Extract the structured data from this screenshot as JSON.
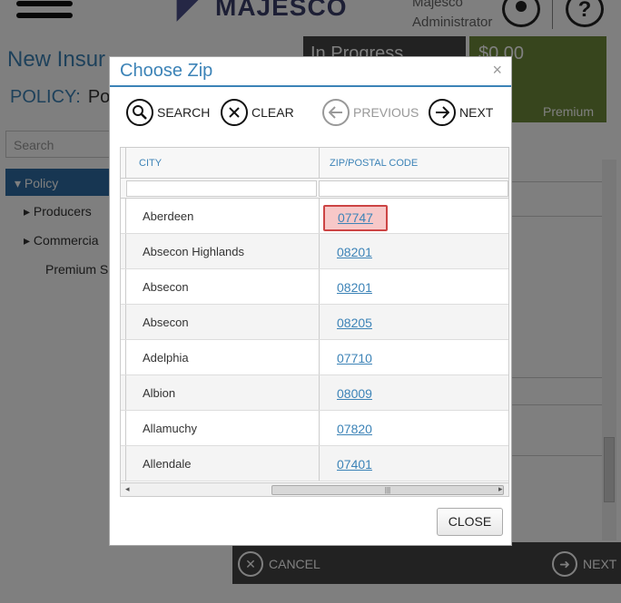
{
  "app": {
    "logo_text": "MAJESCO",
    "user_name": "Majesco",
    "user_role": "Administrator",
    "help_glyph": "?"
  },
  "page": {
    "title": "New Insur",
    "policy_label": "POLICY:",
    "policy_value": "Pol",
    "status": "In Progress",
    "premium_amount": "$0.00",
    "premium_label": "Premium"
  },
  "sidebar": {
    "search_placeholder": "Search",
    "items": [
      {
        "label": "Policy",
        "selected": true
      },
      {
        "label": "Producers"
      },
      {
        "label": "Commercia"
      },
      {
        "label": "Premium Sı"
      }
    ]
  },
  "footer": {
    "cancel_label": "CANCEL",
    "next_label": "NEXT"
  },
  "dialog": {
    "title": "Choose Zip",
    "close_glyph": "×",
    "toolbar": {
      "search_label": "SEARCH",
      "clear_label": "CLEAR",
      "previous_label": "PREVIOUS",
      "next_label": "NEXT"
    },
    "columns": [
      "CITY",
      "ZIP/POSTAL CODE"
    ],
    "rows": [
      {
        "city": "Aberdeen",
        "zip": "07747",
        "selected": true
      },
      {
        "city": "Absecon Highlands",
        "zip": "08201"
      },
      {
        "city": "Absecon",
        "zip": "08201"
      },
      {
        "city": "Absecon",
        "zip": "08205"
      },
      {
        "city": "Adelphia",
        "zip": "07710"
      },
      {
        "city": "Albion",
        "zip": "08009"
      },
      {
        "city": "Allamuchy",
        "zip": "07820"
      },
      {
        "city": "Allendale",
        "zip": "07401"
      }
    ],
    "close_button_label": "CLOSE"
  },
  "colors": {
    "accent": "#3c83b7",
    "selected_cell_bg": "#f7c8c8",
    "selected_cell_border": "#cc4444",
    "status_bg": "#444444",
    "premium_bg": "#6f8a3a"
  }
}
